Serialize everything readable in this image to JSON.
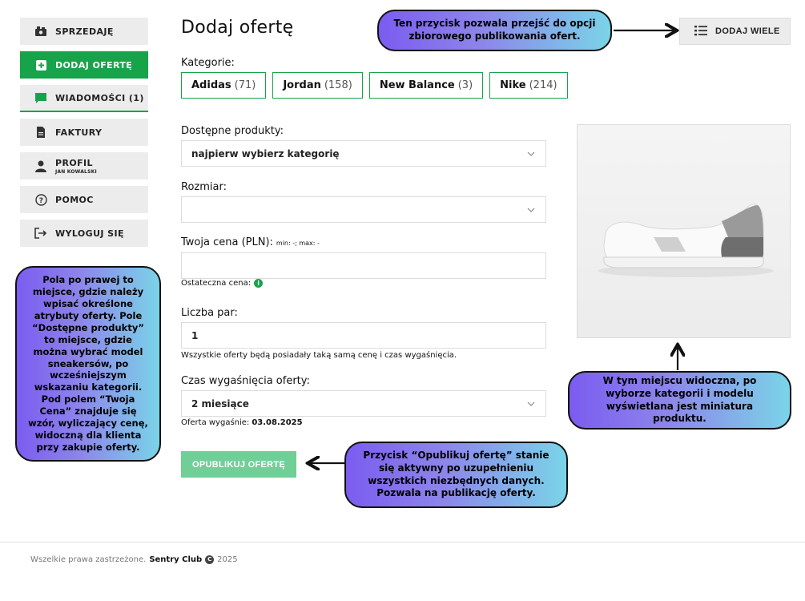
{
  "sidebar": {
    "items": [
      {
        "label": "SPRZEDAJĘ",
        "icon": "cash-icon"
      },
      {
        "label": "DODAJ OFERTĘ",
        "icon": "plus-square-icon"
      },
      {
        "label": "WIADOMOŚCI (1)",
        "icon": "chat-icon"
      },
      {
        "label": "FAKTURY",
        "icon": "document-icon"
      },
      {
        "label": "PROFIL",
        "sub": "JAN KOWALSKI",
        "icon": "user-icon"
      },
      {
        "label": "POMOC",
        "icon": "help-circle-icon"
      },
      {
        "label": "WYLOGUJ SIĘ",
        "icon": "logout-icon"
      }
    ]
  },
  "main": {
    "title": "Dodaj ofertę",
    "add_many_label": "DODAJ WIELE",
    "categories_label": "Kategorie:",
    "categories": [
      {
        "name": "Adidas",
        "count": "(71)"
      },
      {
        "name": "Jordan",
        "count": "(158)"
      },
      {
        "name": "New Balance",
        "count": "(3)"
      },
      {
        "name": "Nike",
        "count": "(214)"
      }
    ],
    "products_label": "Dostępne produkty:",
    "products_value": "najpierw wybierz kategorię",
    "size_label": "Rozmiar:",
    "size_value": "",
    "price_label": "Twoja cena (PLN):",
    "price_range": "min: -; max: -",
    "price_value": "",
    "final_price_label": "Ostateczna cena:",
    "pairs_label": "Liczba par:",
    "pairs_value": "1",
    "pairs_note": "Wszystkie oferty będą posiadały taką samą cenę i czas wygaśnięcia.",
    "expiry_label": "Czas wygaśnięcia oferty:",
    "expiry_value": "2 miesiące",
    "expiry_note_label": "Oferta wygaśnie:",
    "expiry_note_date": "03.08.2025",
    "publish_label": "OPUBLIKUJ OFERTĘ"
  },
  "callouts": {
    "top": "Ten przycisk pozwala przejść do opcji zbiorowego publikowania ofert.",
    "left": "Pola po prawej to miejsce, gdzie należy wpisać określone atrybuty oferty. Pole “Dostępne produkty” to miejsce, gdzie można wybrać model sneakersów, po wcześniejszym wskazaniu kategorii. Pod polem “Twoja Cena” znajduje się wzór, wyliczający cenę, widoczną dla klienta przy zakupie oferty.",
    "right": "W tym miejscu widoczna, po wyborze kategorii i modelu wyświetlana jest miniatura produktu.",
    "bottom": "Przycisk “Opublikuj ofertę” stanie się aktywny po uzupełnieniu wszystkich niezbędnych danych. Pozwala na publikację oferty."
  },
  "footer": {
    "text": "Wszelkie prawa zastrzeżone.",
    "brand": "Sentry Club",
    "year": "2025"
  },
  "colors": {
    "accent": "#17a34a",
    "publish_disabled": "#6fcf97"
  }
}
